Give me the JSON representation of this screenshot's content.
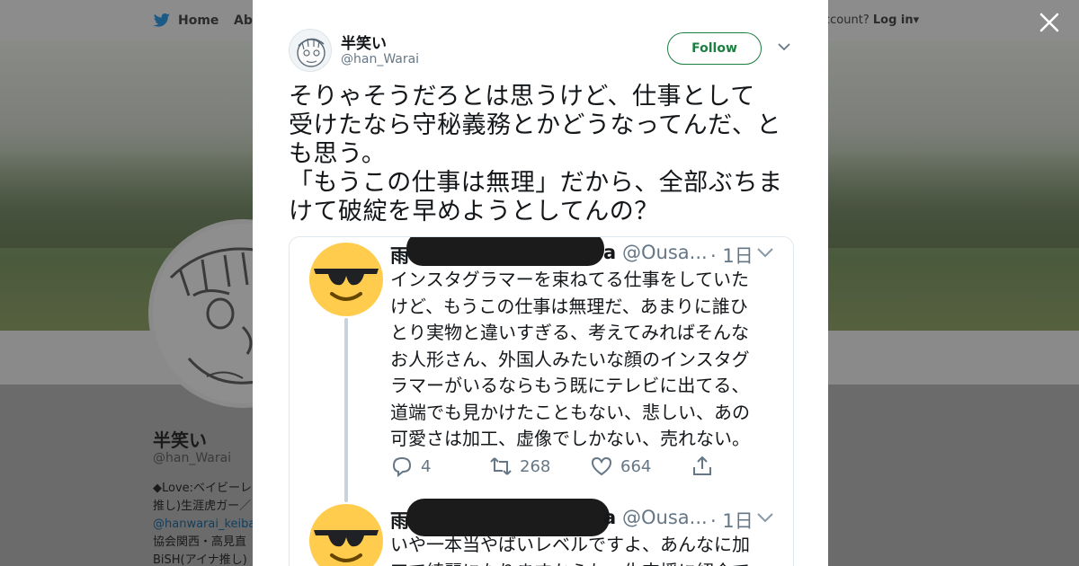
{
  "background": {
    "nav": {
      "home_label": "Home",
      "about_label": "Abo",
      "account_prompt": "ccount?",
      "login_label": "Log in"
    },
    "profile": {
      "name": "半笑い",
      "handle": "@han_Warai",
      "bio_lines": [
        "◆Love:ベイビーレ",
        "推し)生涯虎ガー／",
        "@hanwarai_keiba",
        "協会関西・高見直",
        "BiSH(アイナ推し)"
      ]
    }
  },
  "tweet": {
    "author_name": "半笑い",
    "author_handle": "@han_Warai",
    "follow_label": "Follow",
    "text": "そりゃそうだろとは思うけど、仕事として\n受けたなら守秘義務とかどうなってんだ、と\nも思う。\n「もうこの仕事は無理」だから、全部ぶちま\nけて破綻を早めようとしてんの？"
  },
  "embedded": {
    "post1": {
      "name_visible": "雨",
      "name_suffix": "a",
      "handle": "@Ousa...",
      "time": "· 1日",
      "text": "インスタグラマーを束ねてる仕事をしていた\nけど、もうこの仕事は無理だ、あまりに誰ひ\nとり実物と違いすぎる、考えてみればそんな\nお人形さん、外国人みたいな顔のインスタグ\nラマーがいるならもう既にテレビに出てる、\n道端でも見かけたこともない、悲しい、あの\n可愛さは加工、虚像でしかない、売れない。",
      "replies": "4",
      "retweets": "268",
      "likes": "664"
    },
    "post2": {
      "name_visible": "雨",
      "name_suffix": "a",
      "handle": "@Ousa...",
      "time": "· 1日",
      "text": "いや一本当やばいレベルですよ、あんなに加\n工で綺麗になりますからね、生支援に紹介で"
    }
  },
  "colors": {
    "follow_green": "#1b7f3f",
    "muted_gray": "#657786",
    "text_dark": "#14171a",
    "emoji_yellow": "#ffcc4d"
  },
  "icons": [
    "twitter-bird-icon",
    "close-icon",
    "chevron-down-icon",
    "sunglasses-emoji-icon",
    "reply-icon",
    "retweet-icon",
    "like-icon",
    "share-icon"
  ]
}
